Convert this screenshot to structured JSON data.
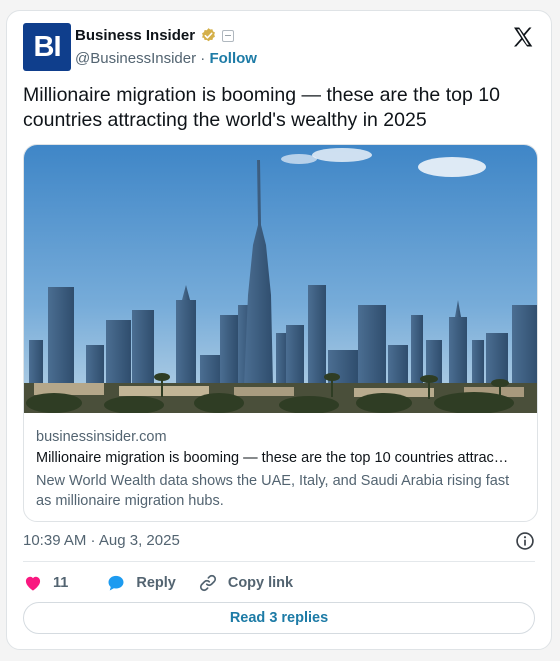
{
  "account": {
    "logo_text": "BI",
    "name": "Business Insider",
    "handle": "@BusinessInsider",
    "separator": "·",
    "follow_label": "Follow"
  },
  "tweet": {
    "text": "Millionaire migration is booming — these are the top 10 countries attracting the world's wealthy in 2025"
  },
  "link_card": {
    "domain": "businessinsider.com",
    "title": "Millionaire migration is booming — these are the top 10 countries attrac…",
    "description": "New World Wealth data shows the UAE, Italy, and Saudi Arabia rising fast as millionaire migration hubs."
  },
  "timestamp": "10:39 AM · Aug 3, 2025",
  "actions": {
    "like_count": "11",
    "reply_label": "Reply",
    "copy_label": "Copy link"
  },
  "read_replies_label": "Read 3 replies",
  "colors": {
    "logo_bg": "#0f3e8c",
    "accent": "#1d7ba6",
    "like": "#f91880",
    "reply_icon": "#1d9bf0",
    "verified_badge": "#d4b04a"
  }
}
